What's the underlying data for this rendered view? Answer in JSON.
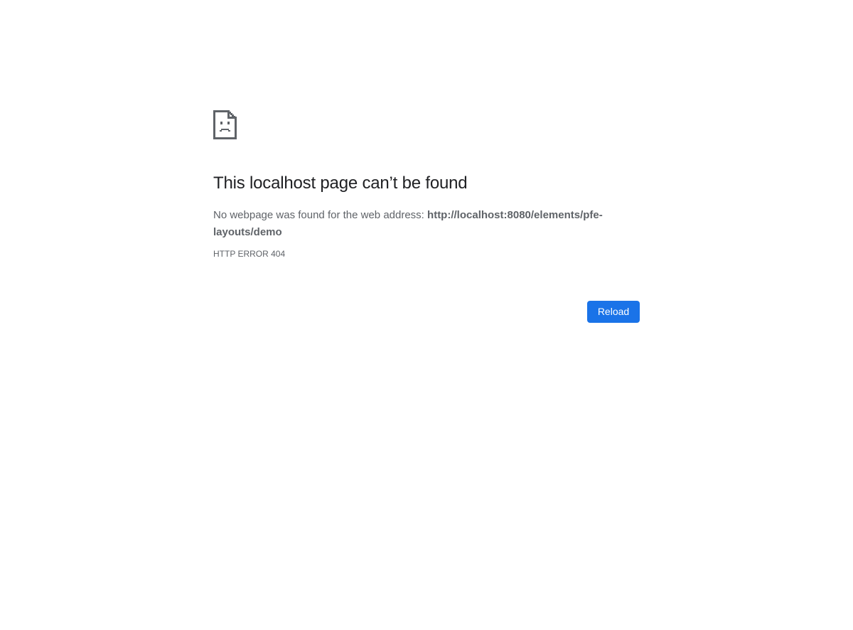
{
  "icon": "sad-document-icon",
  "title": "This localhost page can’t be found",
  "message": {
    "prefix": "No webpage was found for the web address: ",
    "url": "http://localhost:8080/elements/pfe-layouts/demo"
  },
  "error_code": "HTTP ERROR 404",
  "buttons": {
    "reload": "Reload"
  },
  "colors": {
    "button_background": "#1a73e8",
    "title_text": "#202124",
    "body_text": "#5f6368",
    "icon": "#5f6368"
  }
}
